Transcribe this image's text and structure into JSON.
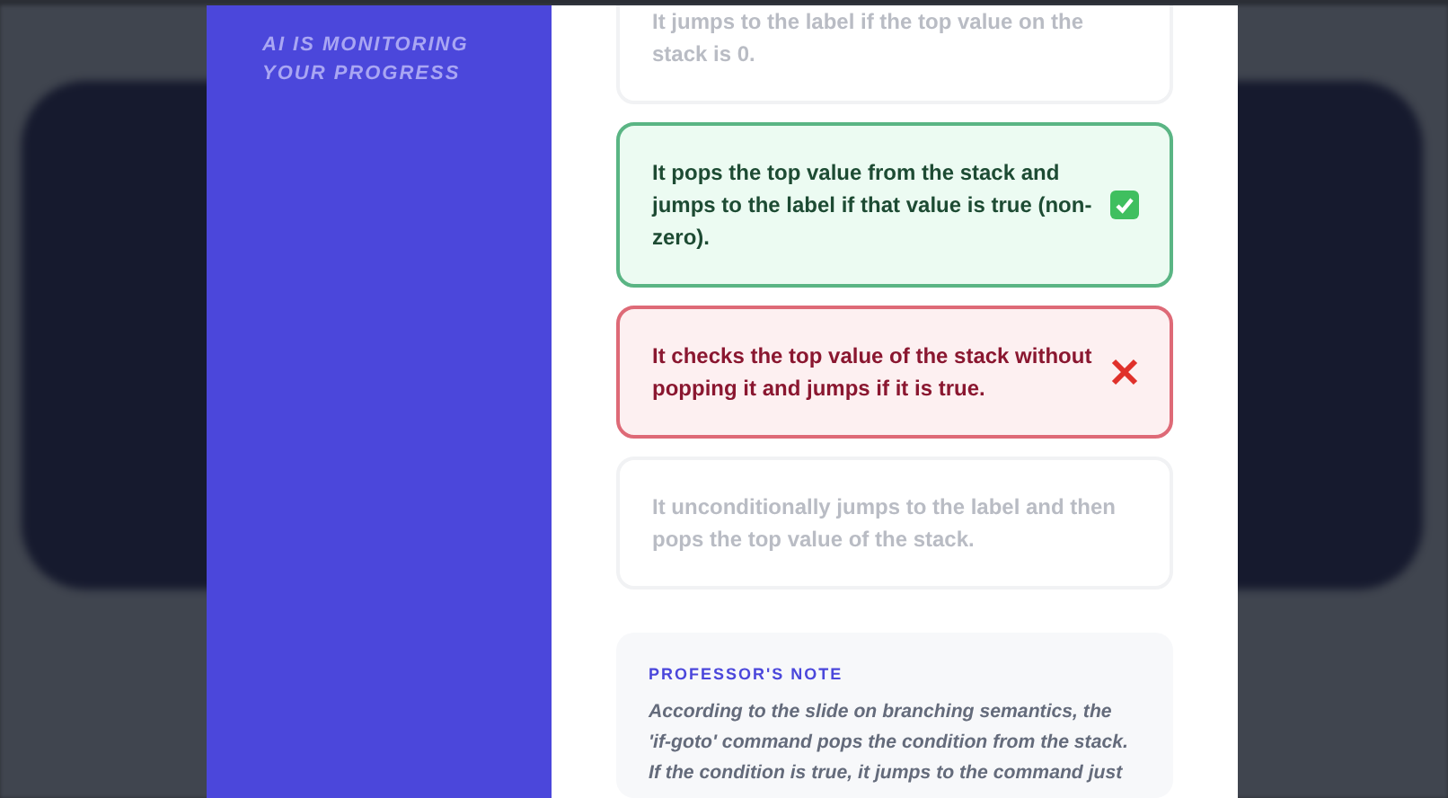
{
  "sidebar": {
    "status": "AI IS MONITORING YOUR PROGRESS"
  },
  "options": [
    {
      "text": "It jumps to the label if the top value on the stack is 0.",
      "kind": "dim"
    },
    {
      "text": "It pops the top value from the stack and jumps to the label if that value is true (non-zero).",
      "kind": "correct"
    },
    {
      "text": "It checks the top value of the stack without popping it and jumps if it is true.",
      "kind": "wrong"
    },
    {
      "text": "It unconditionally jumps to the label and then pops the top value of the stack.",
      "kind": "dim"
    }
  ],
  "note": {
    "title": "PROFESSOR'S NOTE",
    "lines": [
      "According to the slide on branching semantics, the",
      "'if-goto' command pops the condition from the stack.",
      "If the condition is true, it jumps to the command just"
    ]
  }
}
